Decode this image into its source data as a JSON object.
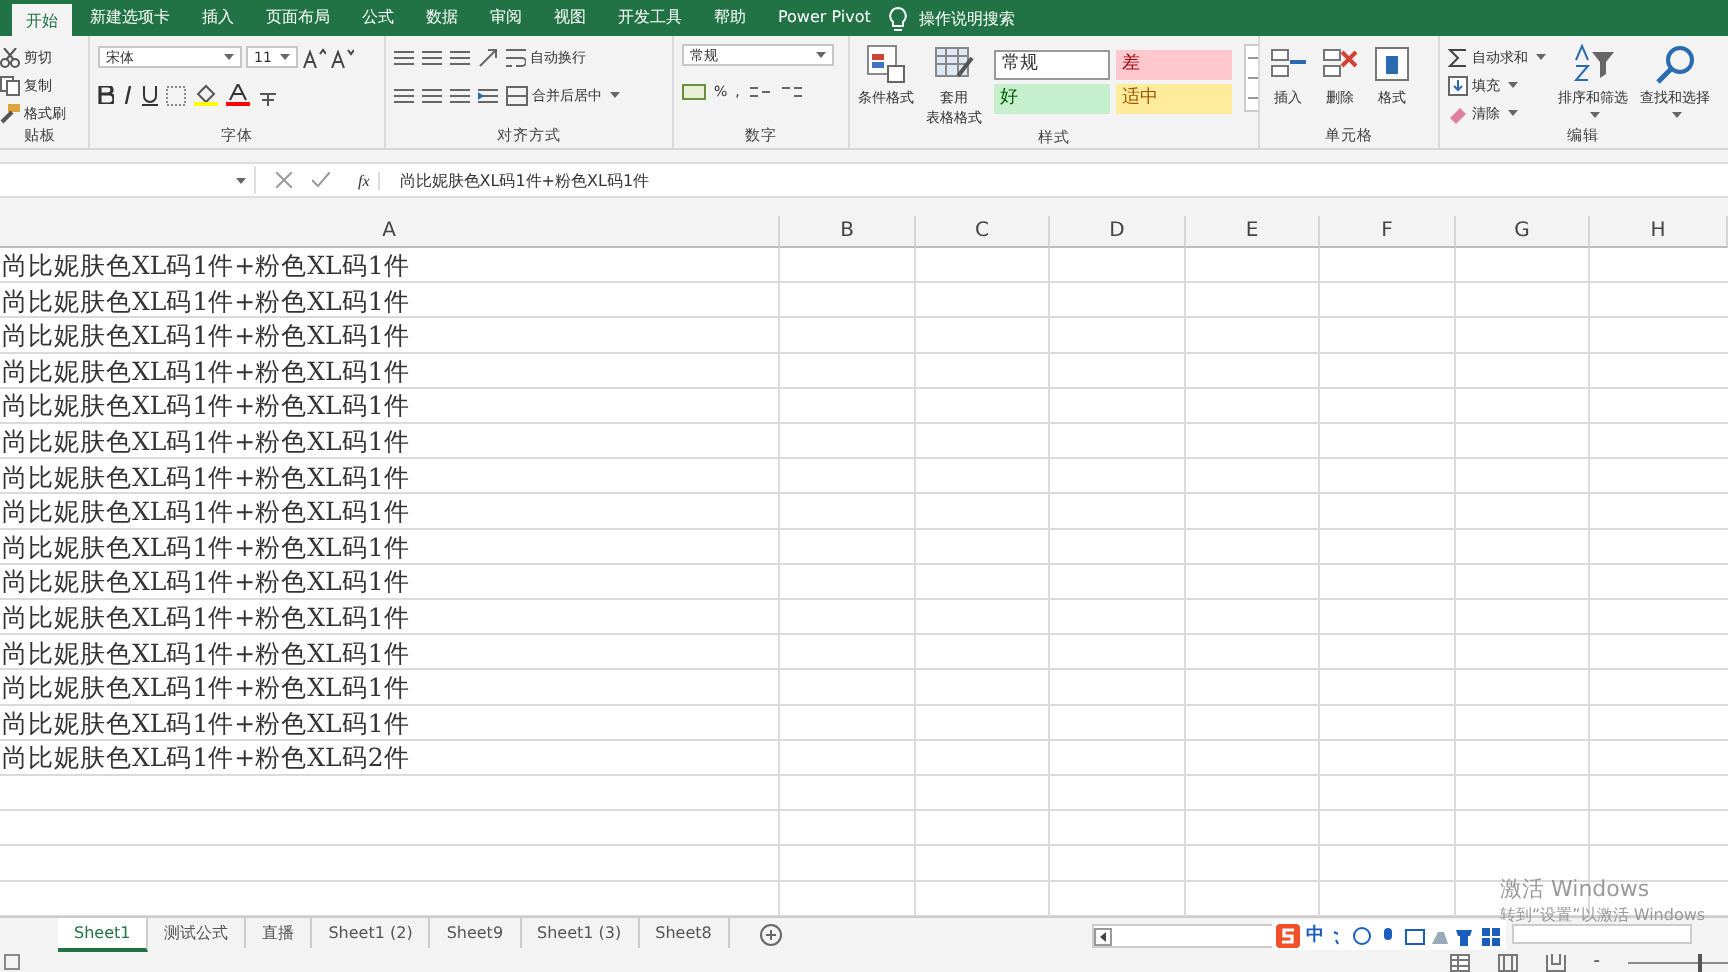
{
  "ribbon_tabs": [
    {
      "label": "开始",
      "selected": true
    },
    {
      "label": "新建选项卡",
      "selected": false
    },
    {
      "label": "插入",
      "selected": false
    },
    {
      "label": "页面布局",
      "selected": false
    },
    {
      "label": "公式",
      "selected": false
    },
    {
      "label": "数据",
      "selected": false
    },
    {
      "label": "审阅",
      "selected": false
    },
    {
      "label": "视图",
      "selected": false
    },
    {
      "label": "开发工具",
      "selected": false
    },
    {
      "label": "帮助",
      "selected": false
    },
    {
      "label": "Power Pivot",
      "selected": false
    }
  ],
  "tell_me": "操作说明搜索",
  "ribbon_groups": [
    {
      "kind": "clipboard",
      "label": "贴板",
      "buttons": [
        "剪切",
        "复制",
        "格式刷"
      ]
    },
    {
      "kind": "font",
      "label": "字体",
      "font_name": "宋体",
      "font_size": "11"
    },
    {
      "kind": "alignment",
      "label": "对齐方式",
      "wrap": "自动换行",
      "merge": "合并后居中"
    },
    {
      "kind": "number",
      "label": "数字",
      "format": "常规",
      "percent": "%",
      "comma": ","
    },
    {
      "kind": "styles",
      "label": "样式",
      "conditional": "条件格式",
      "table_format": [
        "套用",
        "表格格式"
      ],
      "cell_styles": [
        {
          "label": "常规",
          "color": "#ffffff"
        },
        {
          "label": "差",
          "color": "#ffc7ce"
        },
        {
          "label": "好",
          "color": "#c6efce"
        },
        {
          "label": "适中",
          "color": "#ffeb9c"
        }
      ]
    },
    {
      "kind": "cells",
      "label": "单元格",
      "buttons": [
        "插入",
        "删除",
        "格式"
      ]
    },
    {
      "kind": "editing",
      "label": "编辑",
      "small": [
        "自动求和",
        "填充",
        "清除"
      ],
      "big": [
        "排序和筛选",
        "查找和选择"
      ]
    }
  ],
  "formula_bar": {
    "function_label": "fx",
    "formula": "尚比妮肤色XL码1件+粉色XL码1件"
  },
  "columns": [
    "A",
    "B",
    "C",
    "D",
    "E",
    "F",
    "G",
    "H"
  ],
  "rows": [
    "尚比妮肤色XL码1件+粉色XL码1件",
    "尚比妮肤色XL码1件+粉色XL码1件",
    "尚比妮肤色XL码1件+粉色XL码1件",
    "尚比妮肤色XL码1件+粉色XL码1件",
    "尚比妮肤色XL码1件+粉色XL码1件",
    "尚比妮肤色XL码1件+粉色XL码1件",
    "尚比妮肤色XL码1件+粉色XL码1件",
    "尚比妮肤色XL码1件+粉色XL码1件",
    "尚比妮肤色XL码1件+粉色XL码1件",
    "尚比妮肤色XL码1件+粉色XL码1件",
    "尚比妮肤色XL码1件+粉色XL码1件",
    "尚比妮肤色XL码1件+粉色XL码1件",
    "尚比妮肤色XL码1件+粉色XL码1件",
    "尚比妮肤色XL码1件+粉色XL码1件",
    "尚比妮肤色XL码1件+粉色XL码2件"
  ],
  "sheet_tabs": [
    {
      "label": "Sheet1",
      "selected": true
    },
    {
      "label": "测试公式",
      "selected": false
    },
    {
      "label": "直播",
      "selected": false
    },
    {
      "label": "Sheet1 (2)",
      "selected": false
    },
    {
      "label": "Sheet9",
      "selected": false
    },
    {
      "label": "Sheet1 (3)",
      "selected": false
    },
    {
      "label": "Sheet8",
      "selected": false
    }
  ],
  "activation_notice": {
    "title": "激活 Windows",
    "hint": "转到“设置”以激活 Windows"
  },
  "ime_toolbar": {
    "mode": "中"
  },
  "zoom_slider": {
    "minus": "-",
    "level": 0.7
  }
}
